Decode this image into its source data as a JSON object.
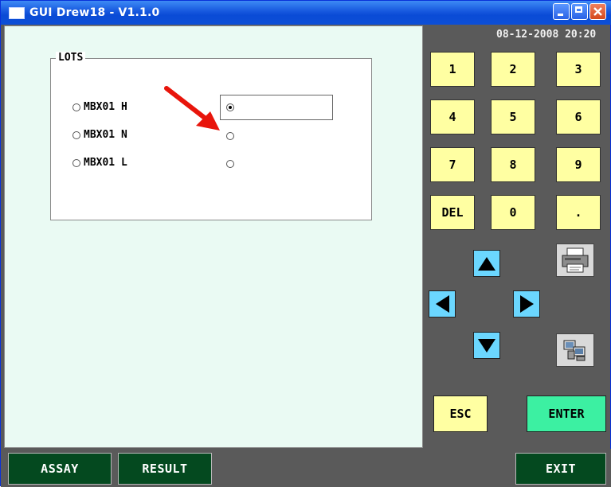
{
  "window": {
    "title": "GUI Drew18 - V1.1.0",
    "controls": {
      "minimize": "minimize-icon",
      "maximize": "maximize-icon",
      "close": "close-icon"
    }
  },
  "lots": {
    "legend": "LOTS",
    "options": [
      {
        "label": "MBX01 H",
        "selected": true
      },
      {
        "label": "MBX01 N",
        "selected": false
      },
      {
        "label": "MBX01 L",
        "selected": false
      }
    ],
    "value_input": ""
  },
  "datetime": "08-12-2008 20:20",
  "keypad": {
    "keys": [
      "1",
      "2",
      "3",
      "4",
      "5",
      "6",
      "7",
      "8",
      "9",
      "DEL",
      "0",
      "."
    ]
  },
  "navigation": {
    "up": "arrow-up-icon",
    "down": "arrow-down-icon",
    "left": "arrow-left-icon",
    "right": "arrow-right-icon"
  },
  "icons": {
    "printer": "printer-icon",
    "computers": "network-computers-icon"
  },
  "actions": {
    "esc": "ESC",
    "enter": "ENTER"
  },
  "bottom_bar": {
    "assay": "ASSAY",
    "result": "RESULT",
    "exit": "EXIT"
  },
  "colors": {
    "keypad_yellow": "#ffffa2",
    "nav_blue": "#6bd7ff",
    "enter_green": "#3cf0a2",
    "bottom_button_green": "#04491f",
    "panel_bg": "#eafaf3",
    "window_bg": "#5a5a5a"
  }
}
